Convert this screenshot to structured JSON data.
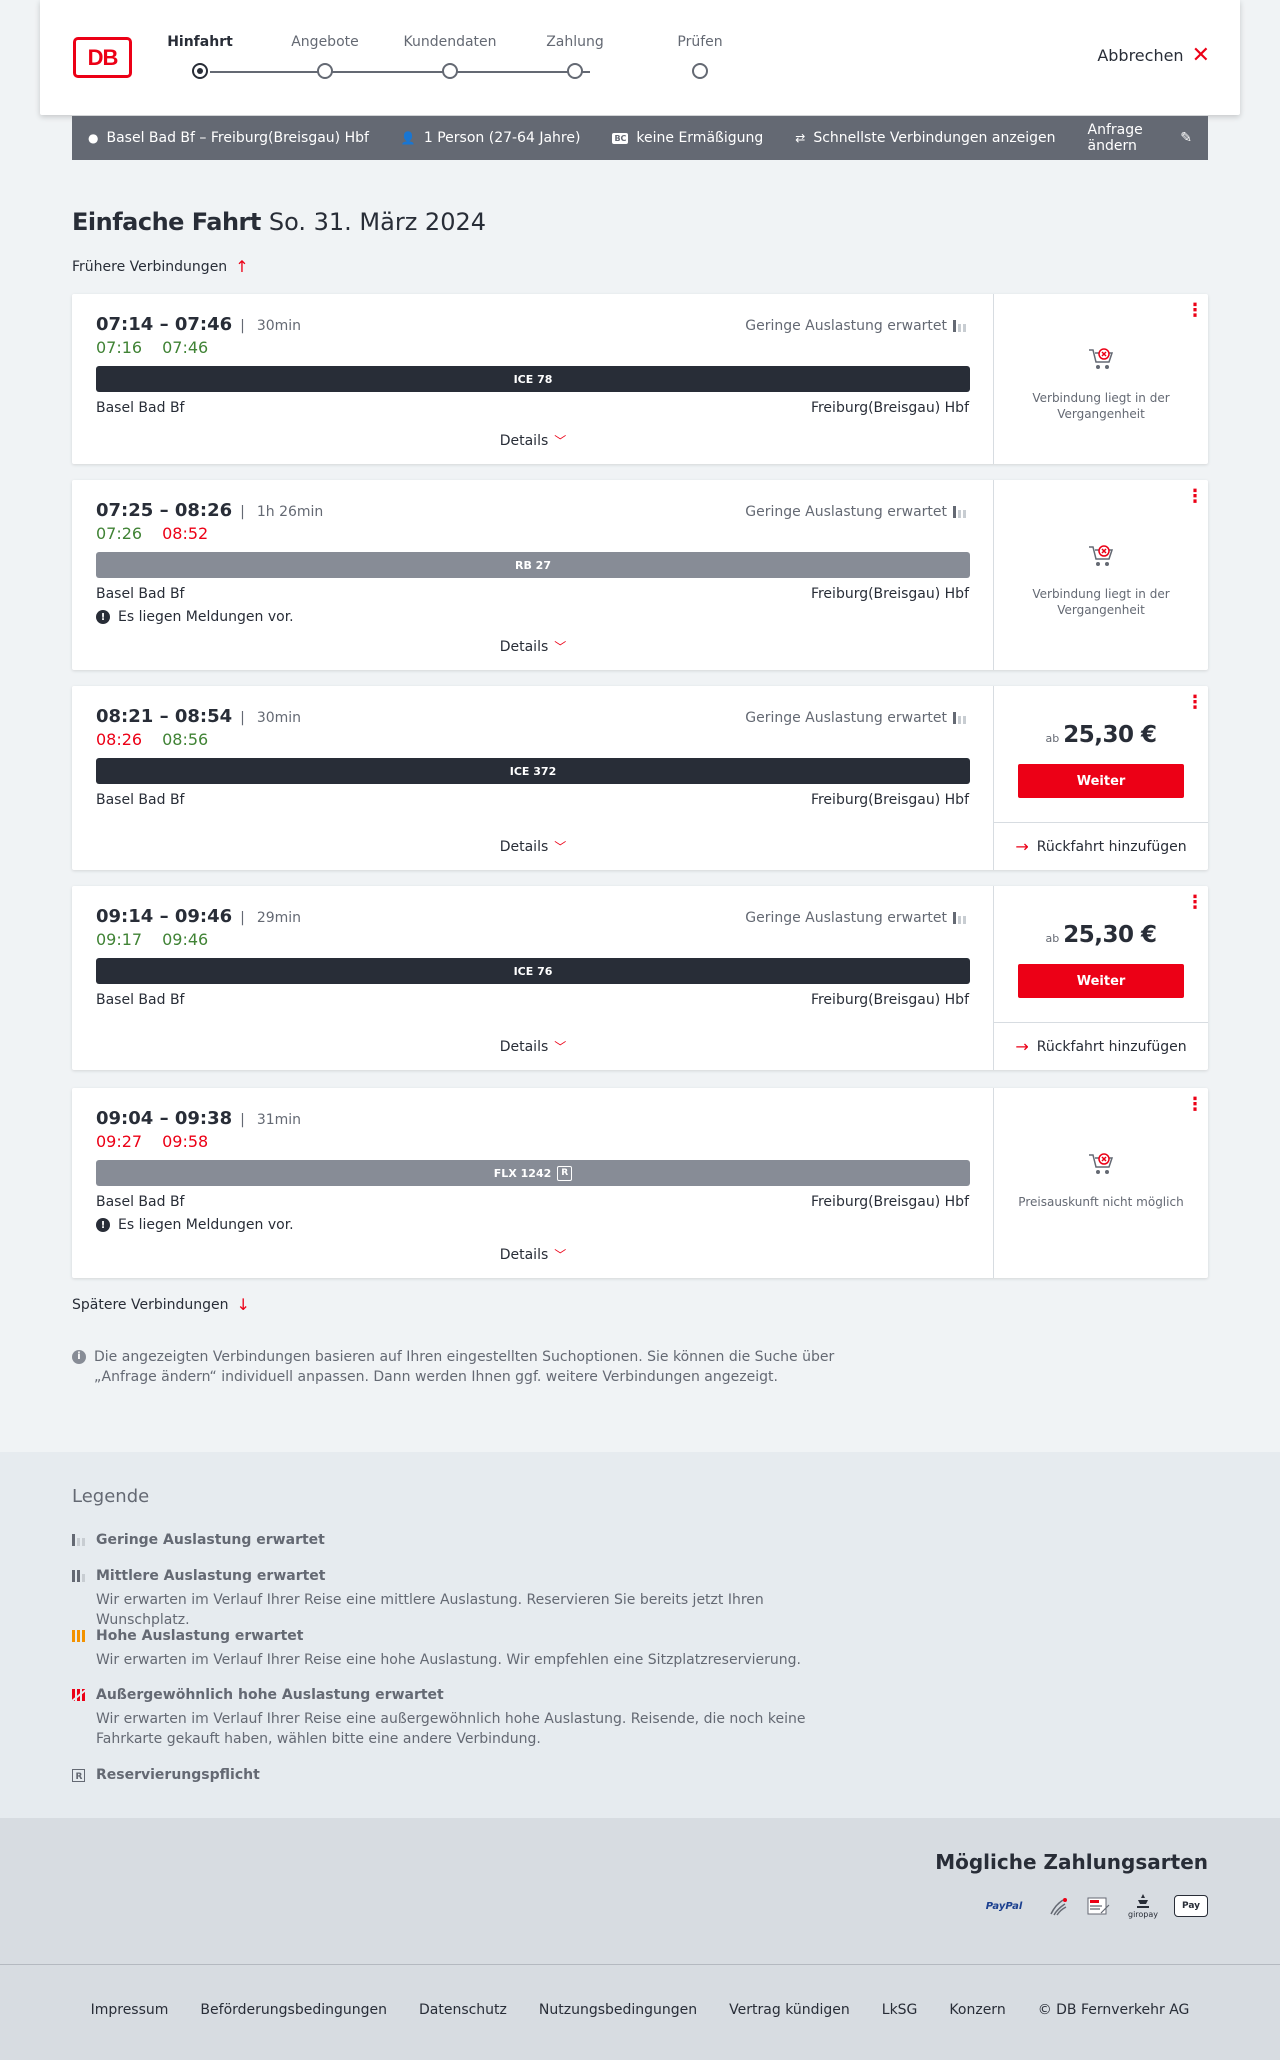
{
  "header": {
    "logo_text": "DB",
    "cancel_label": "Abbrechen",
    "steps": [
      {
        "label": "Hinfahrt",
        "active": true
      },
      {
        "label": "Angebote",
        "active": false
      },
      {
        "label": "Kundendaten",
        "active": false
      },
      {
        "label": "Zahlung",
        "active": false
      },
      {
        "label": "Prüfen",
        "active": false
      }
    ]
  },
  "search": {
    "route": "Basel Bad Bf – Freiburg(Breisgau) Hbf",
    "travellers": "1 Person (27-64 Jahre)",
    "discount_badge": "BC",
    "discount": "keine Ermäßigung",
    "option": "Schnellste Verbindungen anzeigen",
    "edit": "Anfrage ändern"
  },
  "page": {
    "title_bold": "Einfache Fahrt",
    "title_date": "So. 31. März 2024",
    "earlier": "Frühere Verbindungen",
    "later": "Spätere Verbindungen",
    "note": "Die angezeigten Verbindungen basieren auf Ihren eingestellten Suchoptionen. Sie können die Suche über „Anfrage ändern“ individuell anpassen. Dann werden Ihnen ggf. weitere Verbindungen angezeigt."
  },
  "connections": [
    {
      "times": "07:14 – 07:46",
      "duration": "30min",
      "rt_dep": "07:16",
      "rt_dep_status": "ok",
      "rt_arr": "07:46",
      "rt_arr_status": "ok",
      "load": "Geringe Auslastung erwartet",
      "train": "ICE 78",
      "from": "Basel Bad Bf",
      "to": "Freiburg(Breisgau) Hbf",
      "details": "Details",
      "side_text": "Verbindung liegt in der Vergangenheit"
    },
    {
      "times": "07:25 – 08:26",
      "duration": "1h 26min",
      "rt_dep": "07:26",
      "rt_dep_status": "ok",
      "rt_arr": "08:52",
      "rt_arr_status": "late",
      "load": "Geringe Auslastung erwartet",
      "train": "RB 27",
      "from": "Basel Bad Bf",
      "to": "Freiburg(Breisgau) Hbf",
      "message": "Es liegen Meldungen vor.",
      "details": "Details",
      "side_text": "Verbindung liegt in der Vergangenheit"
    },
    {
      "times": "08:21 – 08:54",
      "duration": "30min",
      "rt_dep": "08:26",
      "rt_dep_status": "late",
      "rt_arr": "08:56",
      "rt_arr_status": "ok",
      "load": "Geringe Auslastung erwartet",
      "train": "ICE 372",
      "from": "Basel Bad Bf",
      "to": "Freiburg(Breisgau) Hbf",
      "details": "Details",
      "price_prefix": "ab",
      "price": "25,30 €",
      "cta": "Weiter",
      "return": "Rückfahrt hinzufügen"
    },
    {
      "times": "09:14 – 09:46",
      "duration": "29min",
      "rt_dep": "09:17",
      "rt_dep_status": "ok",
      "rt_arr": "09:46",
      "rt_arr_status": "ok",
      "load": "Geringe Auslastung erwartet",
      "train": "ICE 76",
      "from": "Basel Bad Bf",
      "to": "Freiburg(Breisgau) Hbf",
      "details": "Details",
      "price_prefix": "ab",
      "price": "25,30 €",
      "cta": "Weiter",
      "return": "Rückfahrt hinzufügen"
    },
    {
      "times": "09:04 – 09:38",
      "duration": "31min",
      "rt_dep": "09:27",
      "rt_dep_status": "late",
      "rt_arr": "09:58",
      "rt_arr_status": "late",
      "train": "FLX 1242",
      "train_badge": "R",
      "from": "Basel Bad Bf",
      "to": "Freiburg(Breisgau) Hbf",
      "message": "Es liegen Meldungen vor.",
      "details": "Details",
      "side_text": "Preisauskunft nicht möglich"
    }
  ],
  "legend": {
    "title": "Legende",
    "items": [
      {
        "title": "Geringe Auslastung erwartet",
        "text": ""
      },
      {
        "title": "Mittlere Auslastung erwartet",
        "text": "Wir erwarten im Verlauf Ihrer Reise eine mittlere Auslastung. Reservieren Sie bereits jetzt Ihren Wunschplatz."
      },
      {
        "title": "Hohe Auslastung erwartet",
        "text": "Wir erwarten im Verlauf Ihrer Reise eine hohe Auslastung. Wir empfehlen eine Sitzplatzreservierung."
      },
      {
        "title": "Außergewöhnlich hohe Auslastung erwartet",
        "text": "Wir erwarten im Verlauf Ihrer Reise eine außergewöhnlich hohe Auslastung. Reisende, die noch keine Fahrkarte gekauft haben, wählen bitte eine andere Verbindung."
      },
      {
        "title": "Reservierungspflicht",
        "text": ""
      }
    ]
  },
  "payment": {
    "title": "Mögliche Zahlungsarten",
    "methods": [
      "PayPal",
      "giropay",
      "Pay"
    ]
  },
  "footer": {
    "links": [
      "Impressum",
      "Beförderungsbedingungen",
      "Datenschutz",
      "Nutzungsbedingungen",
      "Vertrag kündigen",
      "LkSG",
      "Konzern",
      "© DB Fernverkehr AG"
    ]
  },
  "colors": {
    "accent": "#ec0016",
    "dark": "#282d37",
    "grey": "#646973",
    "on_time": "#408335"
  }
}
